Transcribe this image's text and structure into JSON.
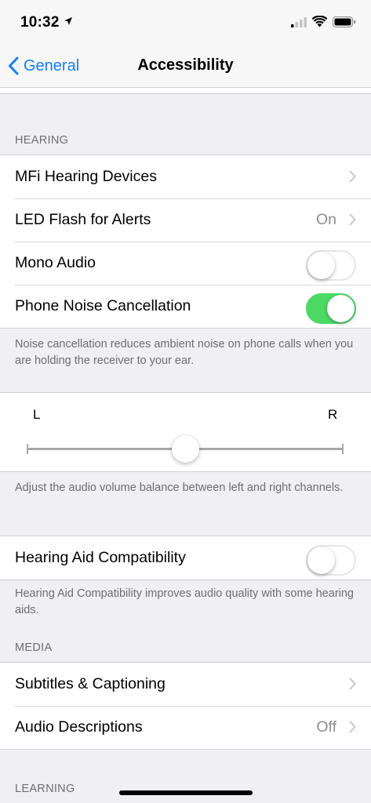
{
  "status_bar": {
    "time": "10:32",
    "icons": [
      "location-arrow-icon",
      "cellular-signal-icon",
      "wifi-icon",
      "battery-icon"
    ]
  },
  "nav": {
    "back_label": "General",
    "title": "Accessibility"
  },
  "hearing": {
    "header": "HEARING",
    "rows": [
      {
        "label": "MFi Hearing Devices",
        "accessory": "chevron"
      },
      {
        "label": "LED Flash for Alerts",
        "value": "On",
        "accessory": "chevron"
      },
      {
        "label": "Mono Audio",
        "accessory": "switch",
        "on": false
      },
      {
        "label": "Phone Noise Cancellation",
        "accessory": "switch",
        "on": true
      }
    ],
    "noise_footer": "Noise cancellation reduces ambient noise on phone calls when you are holding the receiver to your ear."
  },
  "balance": {
    "left_label": "L",
    "right_label": "R",
    "value": 0.5,
    "footer": "Adjust the audio volume balance between left and right channels."
  },
  "hac": {
    "label": "Hearing Aid Compatibility",
    "on": false,
    "footer": "Hearing Aid Compatibility improves audio quality with some hearing aids."
  },
  "media": {
    "header": "MEDIA",
    "rows": [
      {
        "label": "Subtitles & Captioning",
        "accessory": "chevron"
      },
      {
        "label": "Audio Descriptions",
        "value": "Off",
        "accessory": "chevron"
      }
    ]
  },
  "learning": {
    "header": "LEARNING"
  },
  "colors": {
    "accent": "#157efb",
    "switch_on": "#4cd964",
    "background": "#efeff4",
    "secondary_text": "#6d6d72"
  }
}
